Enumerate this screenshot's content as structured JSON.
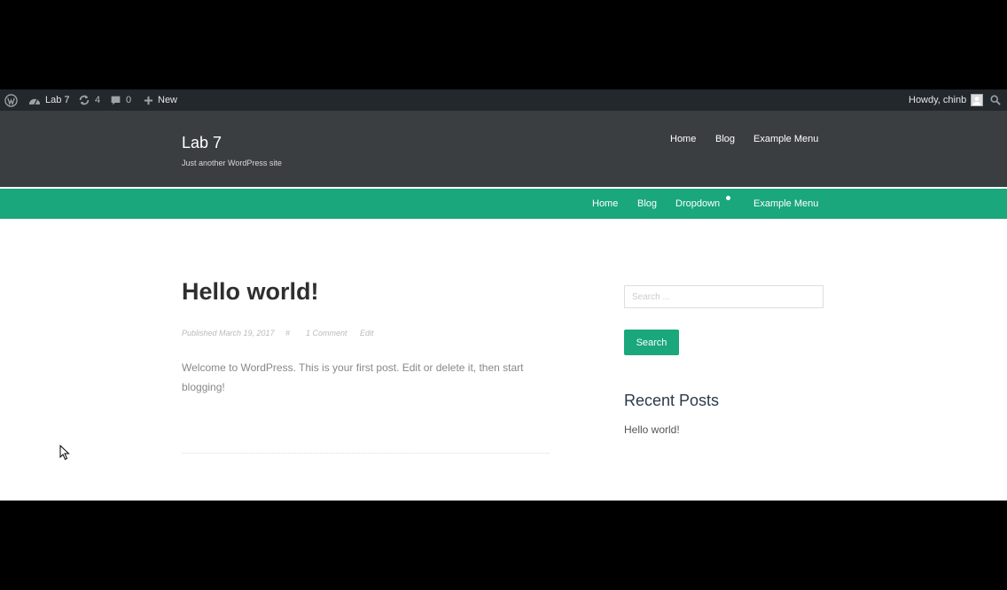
{
  "adminbar": {
    "wp_logo_icon": "wordpress-icon",
    "site_name": "Lab 7",
    "updates_count": "4",
    "comments_count": "0",
    "new_label": "New",
    "howdy": "Howdy, chinb"
  },
  "header": {
    "title": "Lab 7",
    "tagline": "Just another WordPress site",
    "nav": [
      "Home",
      "Blog",
      "Example Menu"
    ]
  },
  "primary_nav": [
    "Home",
    "Blog",
    "Dropdown",
    "Example Menu"
  ],
  "post": {
    "title": "Hello world!",
    "meta": {
      "published": "Published March 19, 2017",
      "hash": "#",
      "comments": "1 Comment",
      "edit": "Edit"
    },
    "excerpt": "Welcome to WordPress. This is your first post. Edit or delete it, then start blogging!"
  },
  "sidebar": {
    "search_placeholder": "Search ...",
    "search_button": "Search",
    "recent_posts_title": "Recent Posts",
    "recent_posts": [
      "Hello world!"
    ]
  },
  "colors": {
    "accent": "#1aa77b",
    "adminbar": "#23282d",
    "header_bg": "#3b3e41"
  }
}
